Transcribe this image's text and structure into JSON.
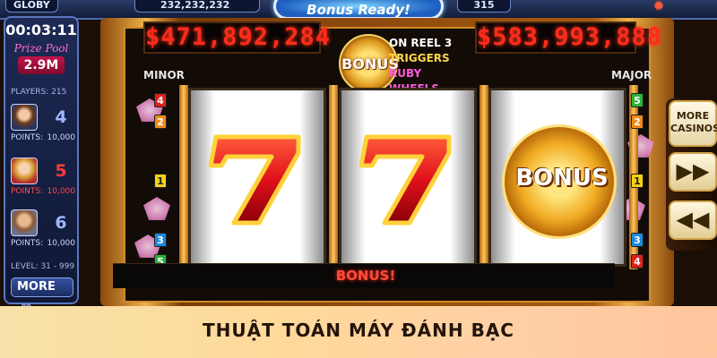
{
  "topbar": {
    "left_seg": "GLOBY",
    "coins": "232,232,232",
    "bonus_ready": "Bonus Ready!",
    "right_seg": "315"
  },
  "left_panel": {
    "timer": "00:03:11",
    "prize_pool_label": "Prize Pool",
    "prize_pool_value": "2.9M",
    "players_label": "PLAYERS: 215",
    "players": [
      {
        "rank": "4",
        "points_label": "POINTS:",
        "points_value": "10,000",
        "rank_color": "#9fb6ff",
        "points_color": "#cdd7ff"
      },
      {
        "rank": "5",
        "points_label": "POINTS:",
        "points_value": "10,000",
        "rank_color": "#ff3b3b",
        "points_color": "#ff4a4a"
      },
      {
        "rank": "6",
        "points_label": "POINTS:",
        "points_value": "10,000",
        "rank_color": "#9fb6ff",
        "points_color": "#cdd7ff"
      }
    ],
    "level_label": "LEVEL: 31 - 999",
    "more_label": "MORE",
    "more_chevrons": "»»"
  },
  "machine": {
    "minor_jackpot": "$471,892,284",
    "minor_label": "MINOR",
    "major_jackpot": "$583,993,888",
    "major_label": "MAJOR",
    "bonus_medal_text": "BONUS",
    "bonus_note": {
      "line1": "ON REEL 3",
      "line2": "TRIGGERS",
      "line3": "RUBY WHEELS"
    },
    "reels": [
      {
        "symbol": "seven-icon"
      },
      {
        "symbol": "seven-icon"
      },
      {
        "symbol": "bonus-icon",
        "text": "BONUS"
      }
    ],
    "left_paylines": [
      "4",
      "2",
      "1",
      "3",
      "5"
    ],
    "right_paylines": [
      "5",
      "2",
      "1",
      "3",
      "4"
    ],
    "bottom_label": "BONUS!"
  },
  "right_panel": {
    "more_casinos_line1": "MORE",
    "more_casinos_line2": "CASINOS",
    "forward_icon": "fast-forward-icon",
    "rewind_icon": "rewind-icon"
  },
  "caption": {
    "text": "THUẬT TOÁN MÁY ĐÁNH BẠC"
  }
}
